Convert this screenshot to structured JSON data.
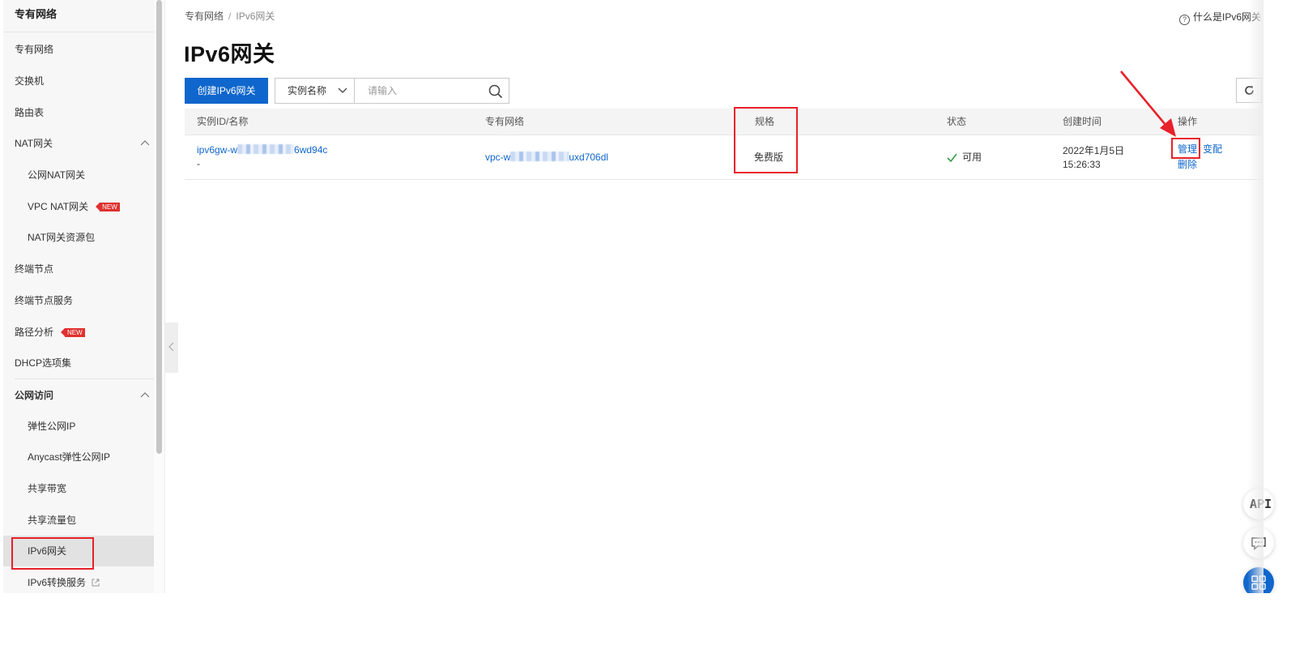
{
  "sidebar": {
    "title": "专有网络",
    "items": [
      {
        "label": "专有网络"
      },
      {
        "label": "交换机"
      },
      {
        "label": "路由表"
      },
      {
        "label": "NAT网关"
      },
      {
        "label": "公网NAT网关"
      },
      {
        "label": "VPC NAT网关",
        "badge": "NEW"
      },
      {
        "label": "NAT网关资源包"
      },
      {
        "label": "终端节点"
      },
      {
        "label": "终端节点服务"
      },
      {
        "label": "路径分析",
        "badge": "NEW"
      },
      {
        "label": "DHCP选项集"
      },
      {
        "label": "公网访问"
      },
      {
        "label": "弹性公网IP"
      },
      {
        "label": "Anycast弹性公网IP"
      },
      {
        "label": "共享带宽"
      },
      {
        "label": "共享流量包"
      },
      {
        "label": "IPv6网关"
      },
      {
        "label": "IPv6转换服务"
      }
    ]
  },
  "breadcrumb": {
    "root": "专有网络",
    "sep": "/",
    "current": "IPv6网关"
  },
  "help_link": "什么是IPv6网关",
  "page_title": "IPv6网关",
  "toolbar": {
    "create_label": "创建IPv6网关",
    "filter_label": "实例名称",
    "search_placeholder": "请输入"
  },
  "table": {
    "headers": [
      "实例ID/名称",
      "专有网络",
      "规格",
      "状态",
      "创建时间",
      "操作"
    ],
    "rows": [
      {
        "id_prefix": "ipv6gw-w",
        "id_suffix": "6wd94c",
        "name": "-",
        "vpc_prefix": "vpc-w",
        "vpc_suffix": "uxd706dl",
        "spec": "免费版",
        "status": "可用",
        "created_date": "2022年1月5日",
        "created_time": "15:26:33",
        "actions": {
          "manage": "管理",
          "change": "变配",
          "delete": "删除"
        }
      }
    ]
  },
  "floating": {
    "api_label": "API"
  },
  "colors": {
    "primary": "#0f66cc",
    "annotation_red": "#e8202a",
    "status_green": "#2f9e44",
    "badge_red": "#e0312f"
  }
}
